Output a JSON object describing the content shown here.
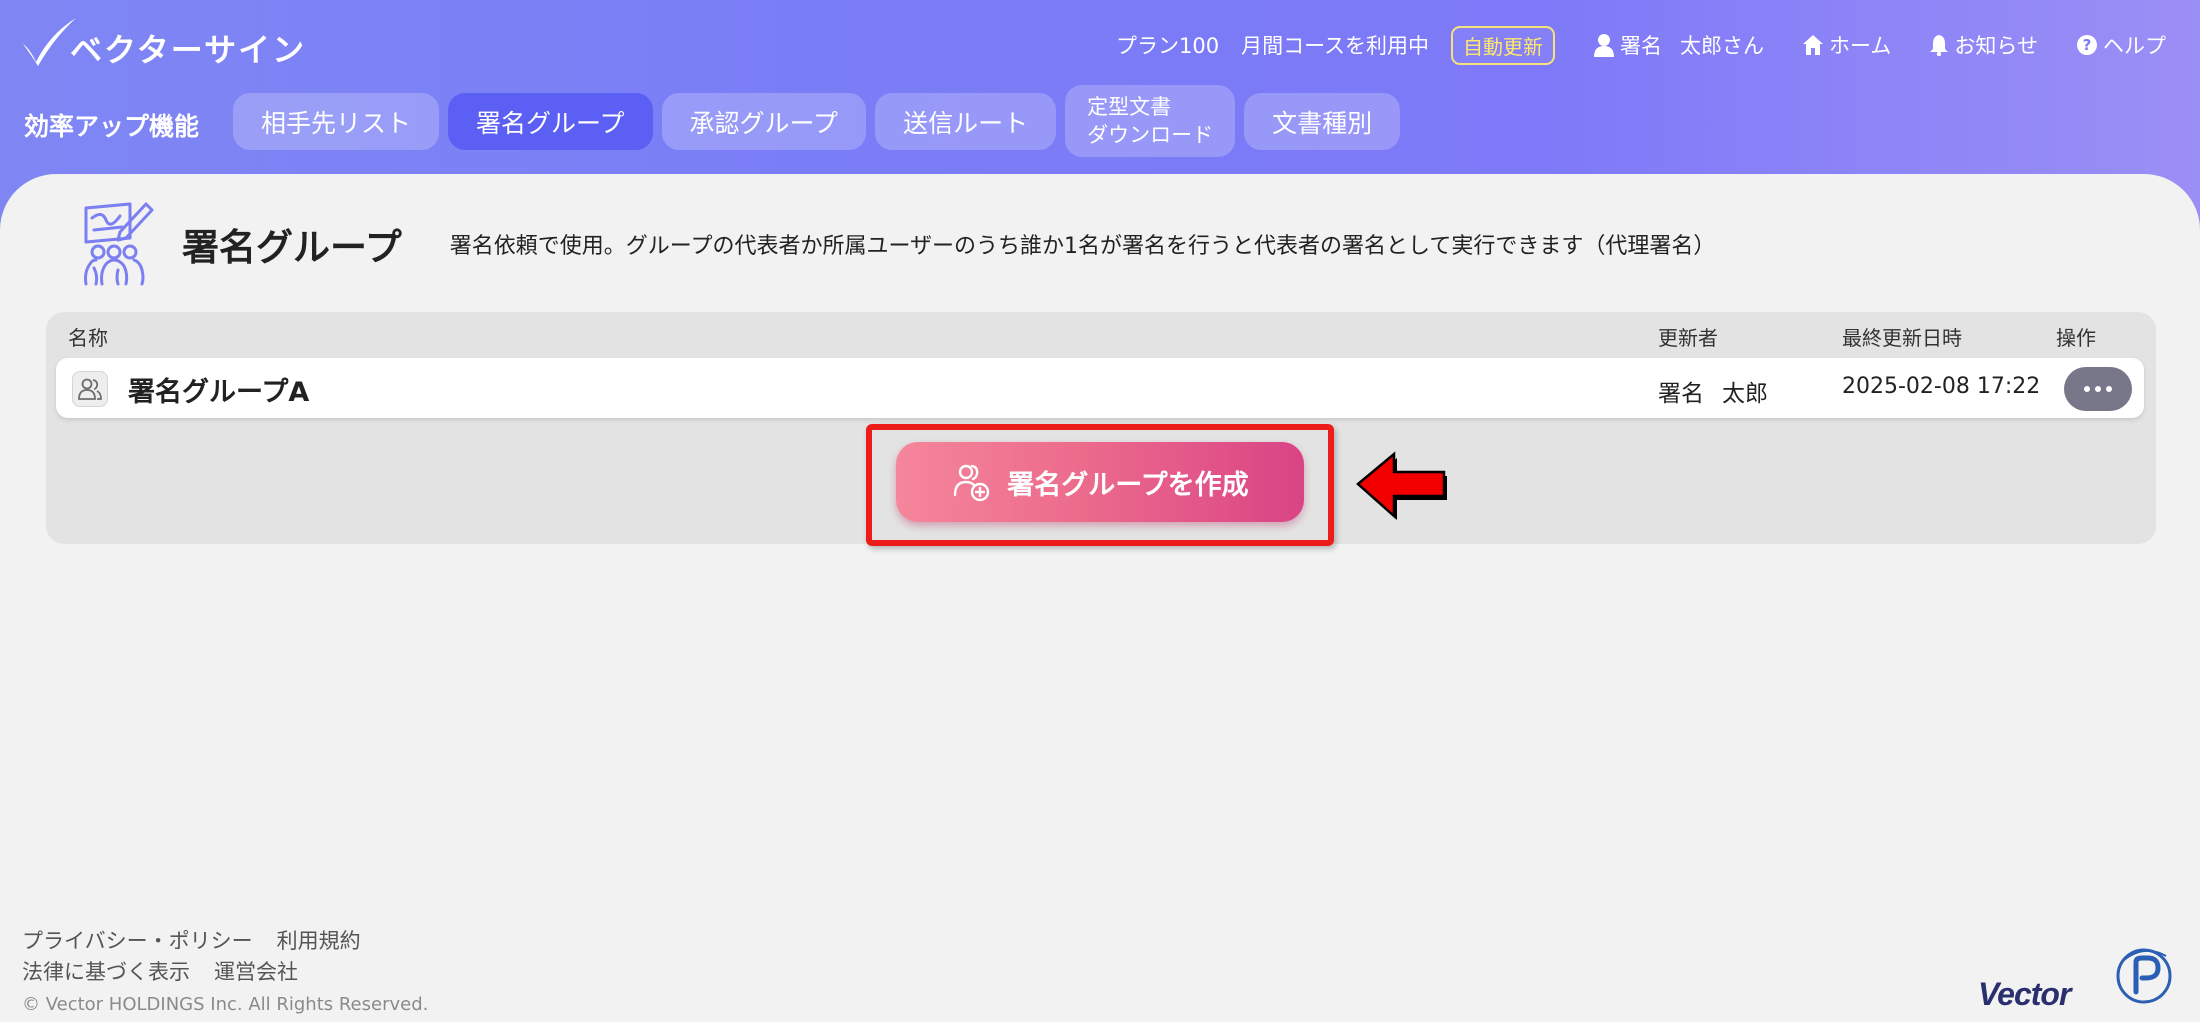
{
  "header": {
    "logo_text": "ベクターサイン",
    "plan_name": "プラン100",
    "plan_course": "月間コースを利用中",
    "auto_renew_badge": "自動更新",
    "user_family": "署名",
    "user_given": "太郎さん",
    "home_label": "ホーム",
    "notice_label": "お知らせ",
    "help_label": "ヘルプ"
  },
  "subnav": {
    "title": "効率アップ機能",
    "tabs": [
      {
        "label": "相手先リスト"
      },
      {
        "label": "署名グループ"
      },
      {
        "label": "承認グループ"
      },
      {
        "label": "送信ルート"
      },
      {
        "line1": "定型文書",
        "line2": "ダウンロード"
      },
      {
        "label": "文書種別"
      }
    ],
    "active_tab": "署名グループ"
  },
  "page": {
    "title": "署名グループ",
    "description": "署名依頼で使用。グループの代表者か所属ユーザーのうち誰か1名が署名を行うと代表者の署名として実行できます（代理署名）"
  },
  "table": {
    "columns": [
      "名称",
      "更新者",
      "最終更新日時",
      "操作"
    ],
    "rows": [
      {
        "name": "署名グループA",
        "updater_family": "署名",
        "updater_given": "太郎",
        "updated_at": "2025-02-08 17:22"
      }
    ]
  },
  "actions": {
    "create_label": "署名グループを作成"
  },
  "footer": {
    "links": [
      "プライバシー・ポリシー",
      "利用規約",
      "法律に基づく表示",
      "運営会社"
    ],
    "copyright": "© Vector HOLDINGS Inc. All Rights Reserved.",
    "brand": "Vector"
  },
  "colors": {
    "header_gradient_start": "#7f86f4",
    "active_tab": "#5b5ff3",
    "auto_renew": "#ffe96a",
    "create_button": "#ec6b8c",
    "highlight": "#ee1b1b"
  },
  "icons": [
    "check-logo-icon",
    "user-icon",
    "home-icon",
    "bell-icon",
    "help-icon",
    "signature-group-icon",
    "group-user-icon",
    "add-user-icon",
    "more-icon",
    "arrow-left-icon",
    "privacy-mark-icon"
  ]
}
